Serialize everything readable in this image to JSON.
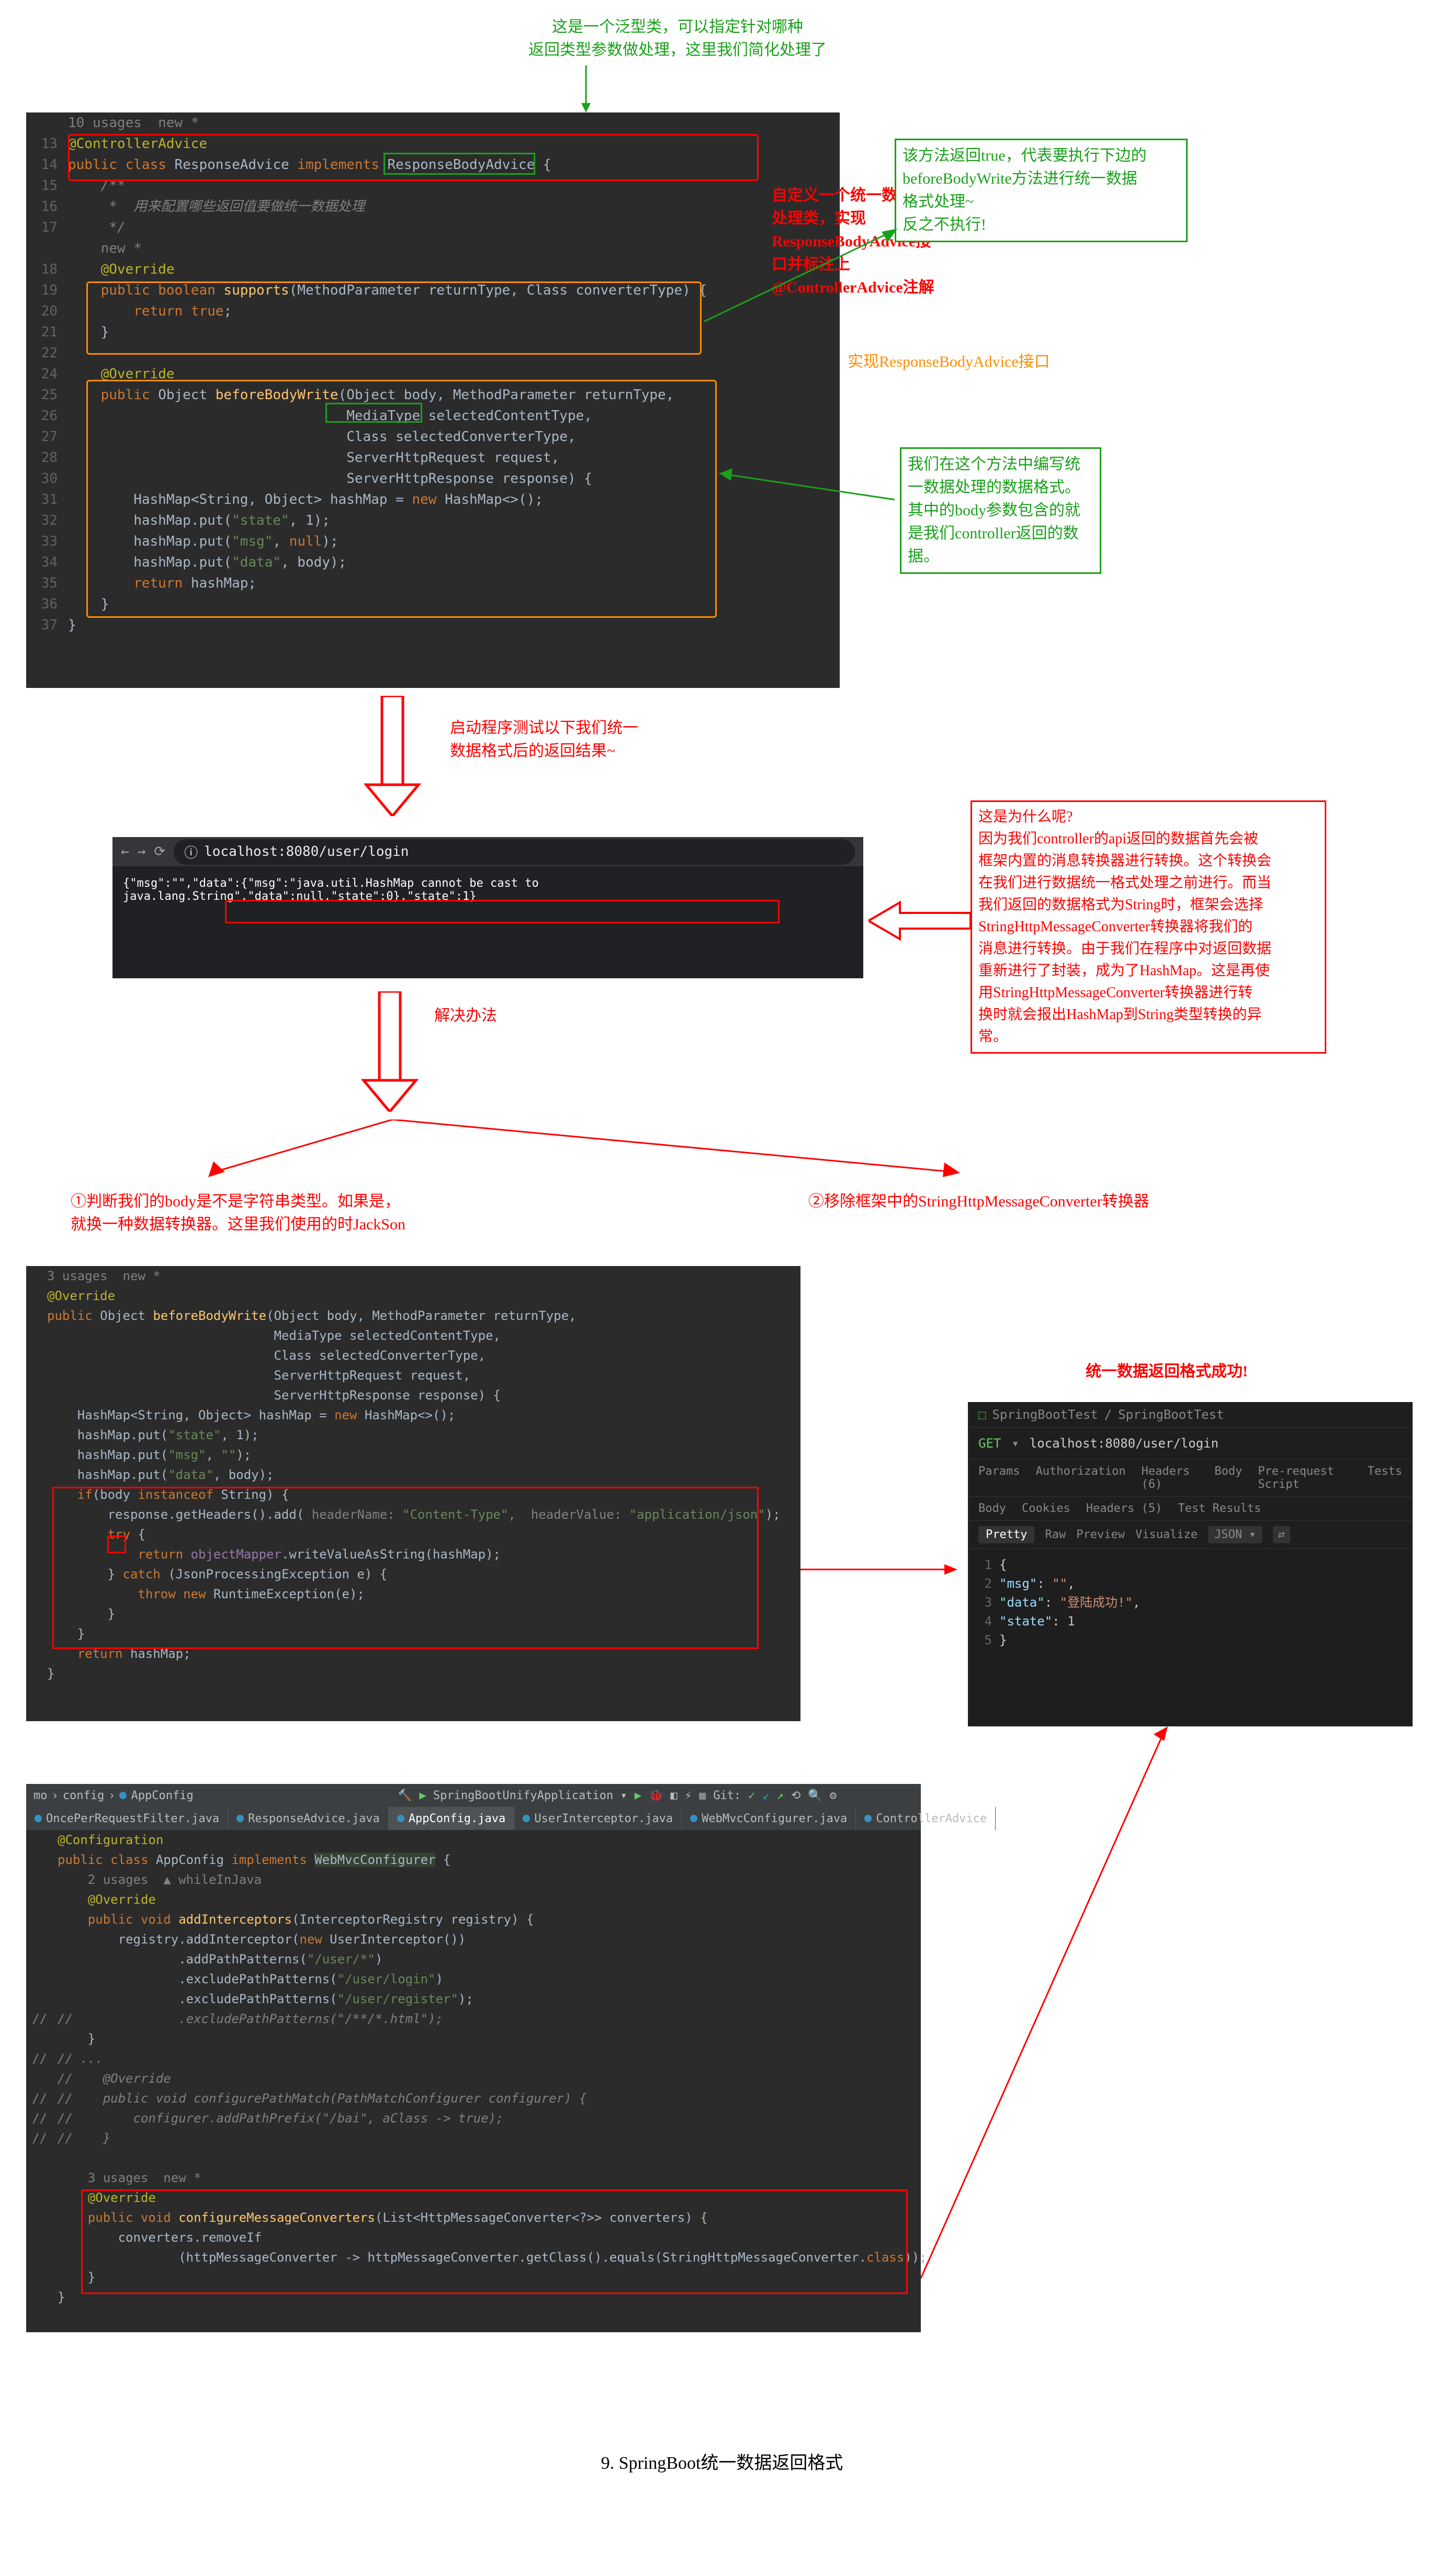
{
  "top_note_green": "这是一个泛型类，可以指定针对哪种\n返回类型参数做处理，这里我们简化处理了",
  "editor1": {
    "line_info": "10 usages  new *",
    "l13_1": "@ControllerAdvice",
    "l14_kw1": "public class ",
    "l14_cls": "ResponseAdvice ",
    "l14_kw2": "implements ",
    "l14_iface": "ResponseBodyAdvice",
    "l14_end": " {",
    "l15": "    /**",
    "l16": "     *  用来配置哪些返回值要做统一数据处理",
    "l17": "     */",
    "l18": "    new *",
    "l19": "    @Override",
    "l20_kw": "    public boolean ",
    "l20_m": "supports",
    "l20_sig": "(MethodParameter returnType, Class converterType) {",
    "l21_kw": "        return ",
    "l21_v": "true",
    "l21_end": ";",
    "l22": "    }",
    "l24": "    @Override",
    "l25_kw": "    public ",
    "l25_t": "Object ",
    "l25_m": "beforeBodyWrite",
    "l25_p1": "(Object body",
    "l25_p2": ", MethodParameter returnType,",
    "l26": "                                  MediaType selectedContentType,",
    "l27": "                                  Class selectedConverterType,",
    "l28": "                                  ServerHttpRequest request,",
    "l29": "                                  ServerHttpResponse response) {",
    "l30": "        HashMap<String, Object> hashMap = ",
    "l30_kw": "new ",
    "l30_end": "HashMap<>();",
    "l31": "        hashMap.put(",
    "l31_s": "\"state\"",
    "l31_end": ", 1);",
    "l32": "        hashMap.put(",
    "l32_s": "\"msg\"",
    "l32_end": ", ",
    "l32_kw": "null",
    "l32_end2": ");",
    "l33": "        hashMap.put(",
    "l33_s": "\"data\"",
    "l33_end": ", body);",
    "l34_kw": "        return ",
    "l34_end": "hashMap;",
    "l35": "    }",
    "l36": "}"
  },
  "note_red_right": "自定义一个统一数据格式\n处理类，实现\nResponseBodyAdvice接\n口并标注上\n@ControllerAdvice注解",
  "note_green_box1": "该方法返回true，代表要执行下边的\nbeforeBodyWrite方法进行统一数据\n格式处理~\n反之不执行!",
  "note_orange": "实现ResponseBodyAdvice接口",
  "note_green_box2": "我们在这个方法中编写统\n一数据处理的数据格式。\n其中的body参数包含的就\n是我们controller返回的数\n据。",
  "arrow_down1_label": "启动程序测试以下我们统一\n数据格式后的返回结果~",
  "browser": {
    "url": "localhost:8080/user/login",
    "response": "{\"msg\":\"\",\"data\":{\"msg\":\"java.util.HashMap cannot be cast to java.lang.String\",\"data\":null,\"state\":0},\"state\":1}"
  },
  "note_red_box1": "这是为什么呢?\n    因为我们controller的api返回的数据首先会被\n框架内置的消息转换器进行转换。这个转换会\n在我们进行数据统一格式处理之前进行。而当\n我们返回的数据格式为String时，框架会选择\nStringHttpMessageConverter转换器将我们的\n消息进行转换。由于我们在程序中对返回数据\n重新进行了封装，成为了HashMap。这是再使\n用StringHttpMessageConverter转换器进行转\n换时就会报出HashMap到String类型转换的异\n常。",
  "solution_label": "解决办法",
  "solution1": "①判断我们的body是不是字符串类型。如果是，\n就换一种数据转换器。这里我们使用的时JackSon",
  "solution2": "②移除框架中的StringHttpMessageConverter转换器",
  "editor2": {
    "hint": "3 usages  new *",
    "l1": "@Override",
    "l2_kw": "public ",
    "l2_t": "Object ",
    "l2_m": "beforeBodyWrite",
    "l2_sig": "(Object body, MethodParameter returnType,",
    "l3": "                              MediaType selectedContentType,",
    "l4": "                              Class selectedConverterType,",
    "l5": "                              ServerHttpRequest request,",
    "l6": "                              ServerHttpResponse response) {",
    "l7": "    HashMap<String, Object> hashMap = ",
    "l7_kw": "new ",
    "l7_end": "HashMap<>();",
    "l8": "    hashMap.put(",
    "l8_s": "\"state\"",
    "l8_end": ", 1);",
    "l9": "    hashMap.put(",
    "l9_s": "\"msg\"",
    "l9_end": ", ",
    "l9_s2": "\"\"",
    "l9_end2": ");",
    "l10": "    hashMap.put(",
    "l10_s": "\"data\"",
    "l10_end": ", body);",
    "l11_kw": "    if",
    "l11_mid": "(body ",
    "l11_kw2": "instanceof ",
    "l11_end": "String) {",
    "l12": "        response.getHeaders().add(",
    "l12_p1": " headerName: ",
    "l12_s1": "\"Content-Type\"",
    "l12_p2": ",  headerValue: ",
    "l12_s2": "\"application/json\"",
    "l12_end": ");",
    "l13_kw": "        try ",
    "l13_end": "{",
    "l14_kw": "            return ",
    "l14_v": "objectMapper",
    "l14_end": ".writeValueAsString(hashMap);",
    "l15_kw": "        } ",
    "l15_kw2": "catch ",
    "l15_end": "(JsonProcessingException e) {",
    "l16_kw": "            throw new ",
    "l16_end": "RuntimeException(e);",
    "l17": "        }",
    "l18": "    }",
    "l19_kw": "    return ",
    "l19_end": "hashMap;",
    "l20": "}"
  },
  "success_label": "统一数据返回格式成功!",
  "api": {
    "crumb1": "SpringBootTest",
    "crumb2": "SpringBootTest",
    "method": "GET",
    "url": "localhost:8080/user/login",
    "tabs": [
      "Params",
      "Authorization",
      "Headers (6)",
      "Body",
      "Pre-request Script",
      "Tests"
    ],
    "respTabs": [
      "Body",
      "Cookies",
      "Headers (5)",
      "Test Results"
    ],
    "viewBar": [
      "Pretty",
      "Raw",
      "Preview",
      "Visualize",
      "JSON"
    ],
    "json_lines": [
      {
        "n": "1",
        "txt": "{"
      },
      {
        "n": "2",
        "txt": "    \"msg\": \"\","
      },
      {
        "n": "3",
        "txt": "    \"data\": \"登陆成功!\","
      },
      {
        "n": "4",
        "txt": "    \"state\": 1"
      },
      {
        "n": "5",
        "txt": "}"
      }
    ]
  },
  "ide_tabs": {
    "crumb": [
      "mo",
      "config",
      "AppConfig"
    ],
    "run_config": "SpringBootUnifyApplication",
    "git": "Git:",
    "files": [
      "OncePerRequestFilter.java",
      "ResponseAdvice.java",
      "AppConfig.java",
      "UserInterceptor.java",
      "WebMvcConfigurer.java",
      "ControllerAdvice"
    ]
  },
  "editor3": {
    "l1": "@Configuration",
    "l2_kw": "public class ",
    "l2_cls": "AppConfig ",
    "l2_kw2": "implements ",
    "l2_iface": "WebMvcConfigurer",
    "l2_end": " {",
    "hint1": "    2 usages  ▲ whileInJava",
    "l3": "    @Override",
    "l4_kw": "    public void ",
    "l4_m": "addInterceptors",
    "l4_sig": "(InterceptorRegistry registry) {",
    "l5": "        registry.addInterceptor(",
    "l5_kw": "new ",
    "l5_end": "UserInterceptor())",
    "l6": "                .addPathPatterns(",
    "l6_s": "\"/user/*\"",
    "l6_end": ")",
    "l7": "                .excludePathPatterns(",
    "l7_s": "\"/user/login\"",
    "l7_end": ")",
    "l8": "                .excludePathPatterns(",
    "l8_s": "\"/user/register\"",
    "l8_end": ");",
    "l9_cmt": "//              .excludePathPatterns(\"/**/*.html\");",
    "l10": "    }",
    "l11_cmt": "// ...",
    "l12_cmt": "//    @Override",
    "l13_cmt": "//    public void configurePathMatch(PathMatchConfigurer configurer) {",
    "l14_cmt": "//        configurer.addPathPrefix(\"/bai\", aClass -> true);",
    "l15_cmt": "//    }",
    "hint2": "    3 usages  new *",
    "l16": "    @Override",
    "l17_kw": "    public void ",
    "l17_m": "configureMessageConverters",
    "l17_sig": "(List<HttpMessageConverter<?>> converters) {",
    "l18": "        converters.removeIf",
    "l19_p1": "                (httpMessageConverter -> httpMessageConverter.getClass().equals(StringHttpMessageConverter.",
    "l19_kw": "class",
    "l19_end": "));",
    "l20": "    }",
    "l21": "}"
  },
  "caption": "9. SpringBoot统一数据返回格式"
}
